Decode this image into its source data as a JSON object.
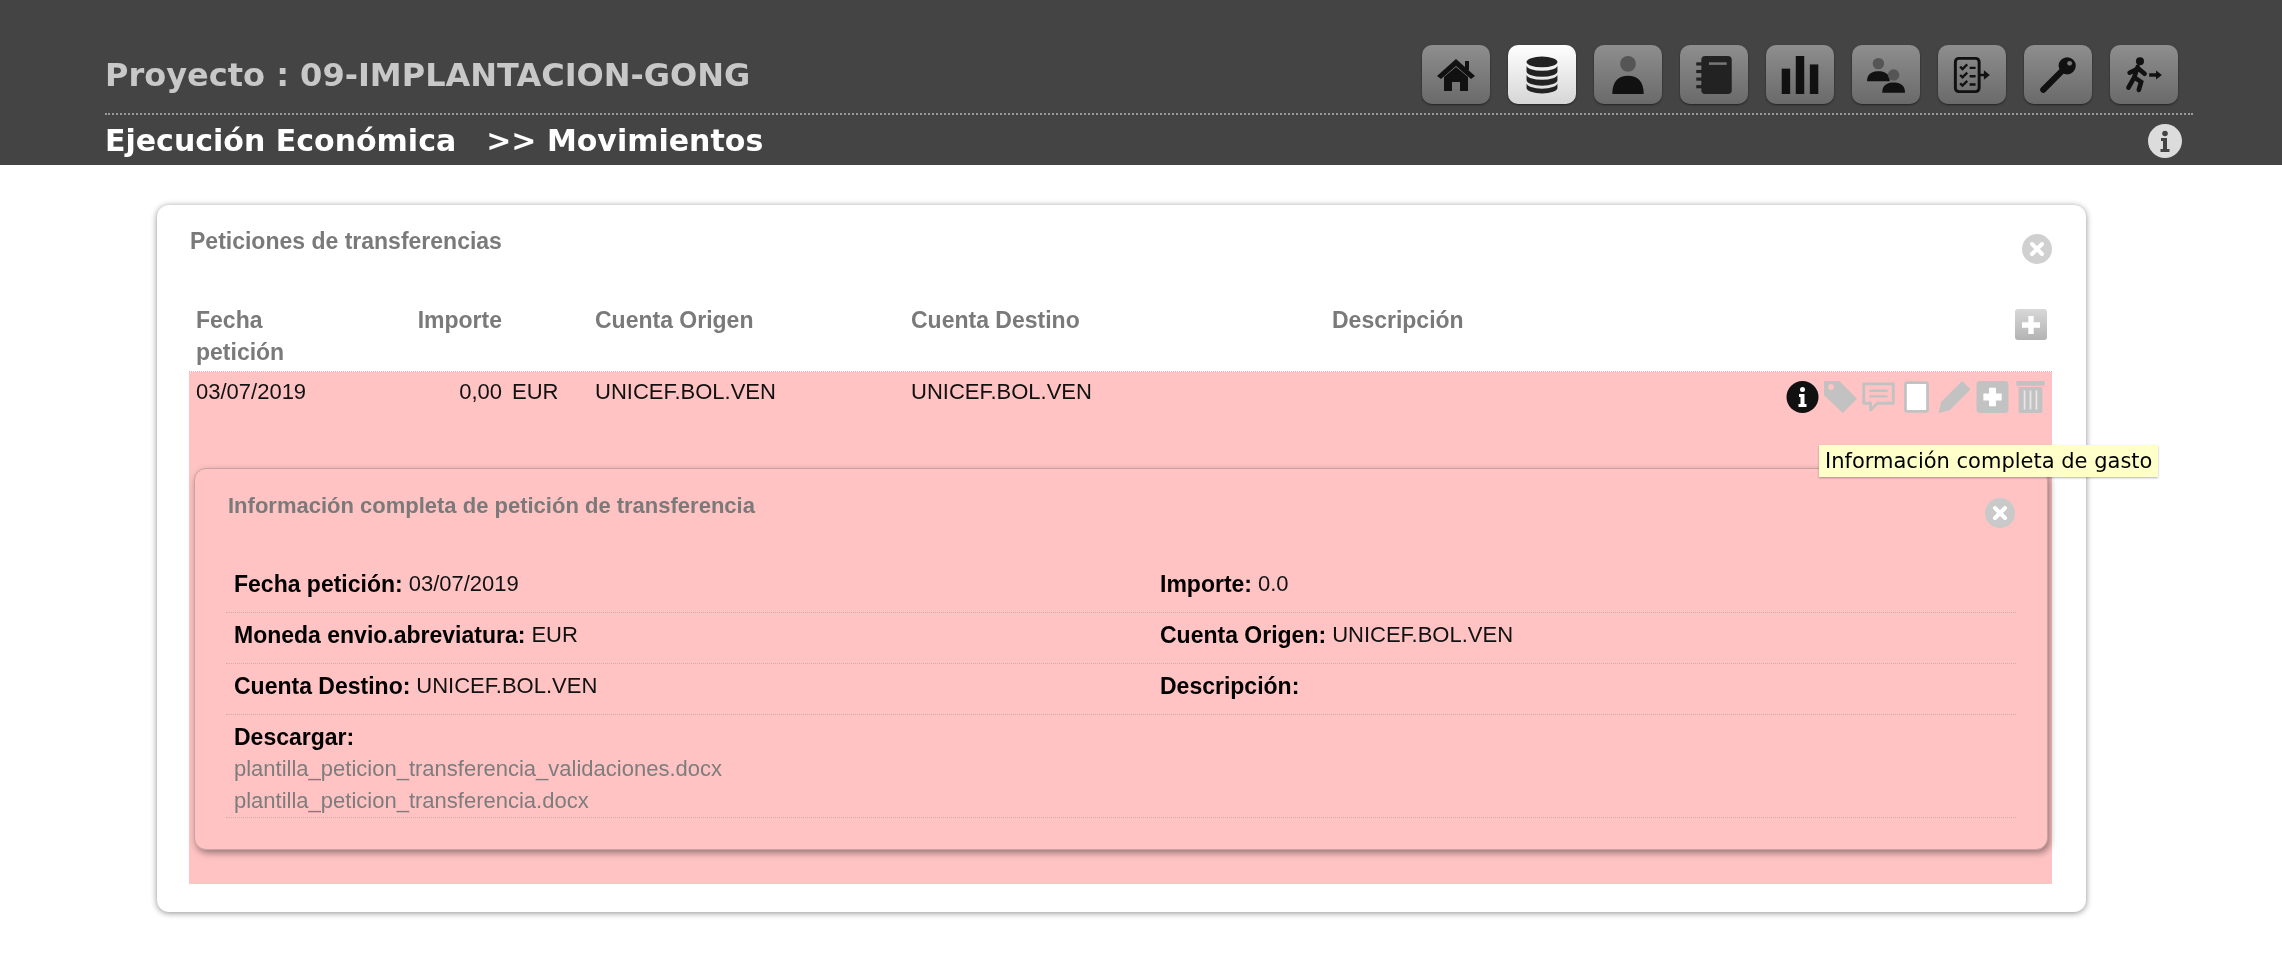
{
  "header": {
    "project_title": "Proyecto : 09-IMPLANTACION-GONG",
    "nav_buttons": [
      {
        "kind": "home",
        "selected": false
      },
      {
        "kind": "database",
        "selected": true
      },
      {
        "kind": "user",
        "selected": false
      },
      {
        "kind": "notebook",
        "selected": false
      },
      {
        "kind": "chart",
        "selected": false
      },
      {
        "kind": "users",
        "selected": false
      },
      {
        "kind": "checklist",
        "selected": false
      },
      {
        "kind": "key",
        "selected": false
      },
      {
        "kind": "exit",
        "selected": false
      }
    ],
    "breadcrumb": [
      "Ejecución Económica",
      ">> Movimientos"
    ]
  },
  "panel": {
    "title": "Peticiones de transferencias",
    "table": {
      "columns": [
        "Fecha petición",
        "Importe",
        "Cuenta Origen",
        "Cuenta Destino",
        "Descripción"
      ],
      "rows": [
        {
          "expanded": true,
          "fecha": "03/07/2019",
          "importe": "0,00",
          "moneda": "EUR",
          "cuenta_origen": "UNICEF.BOL.VEN",
          "cuenta_destino": "UNICEF.BOL.VEN",
          "actions": [
            {
              "kind": "info",
              "disabled": false,
              "tooltip": "Información completa de gasto"
            },
            {
              "kind": "tag",
              "disabled": true
            },
            {
              "kind": "comment",
              "disabled": true
            },
            {
              "kind": "document",
              "disabled": true
            },
            {
              "kind": "edit",
              "disabled": true
            },
            {
              "kind": "add",
              "disabled": true
            },
            {
              "kind": "delete",
              "disabled": true
            }
          ],
          "details": {
            "title": "Información completa de petición de transferencia",
            "fields": [
              {
                "label": "Fecha petición:",
                "value": "03/07/2019"
              },
              {
                "label": "Importe:",
                "value": "0.0"
              },
              {
                "label": "Moneda envio.abreviatura:",
                "value": "EUR"
              },
              {
                "label": "Cuenta Origen:",
                "value": "UNICEF.BOL.VEN"
              },
              {
                "label": "Cuenta Destino:",
                "value": "UNICEF.BOL.VEN"
              },
              {
                "label": "Descripción:"
              }
            ],
            "downloads": {
              "label": "Descargar:",
              "files": [
                "plantilla_peticion_transferencia_validaciones.docx",
                "plantilla_peticion_transferencia.docx"
              ]
            }
          }
        }
      ]
    }
  }
}
